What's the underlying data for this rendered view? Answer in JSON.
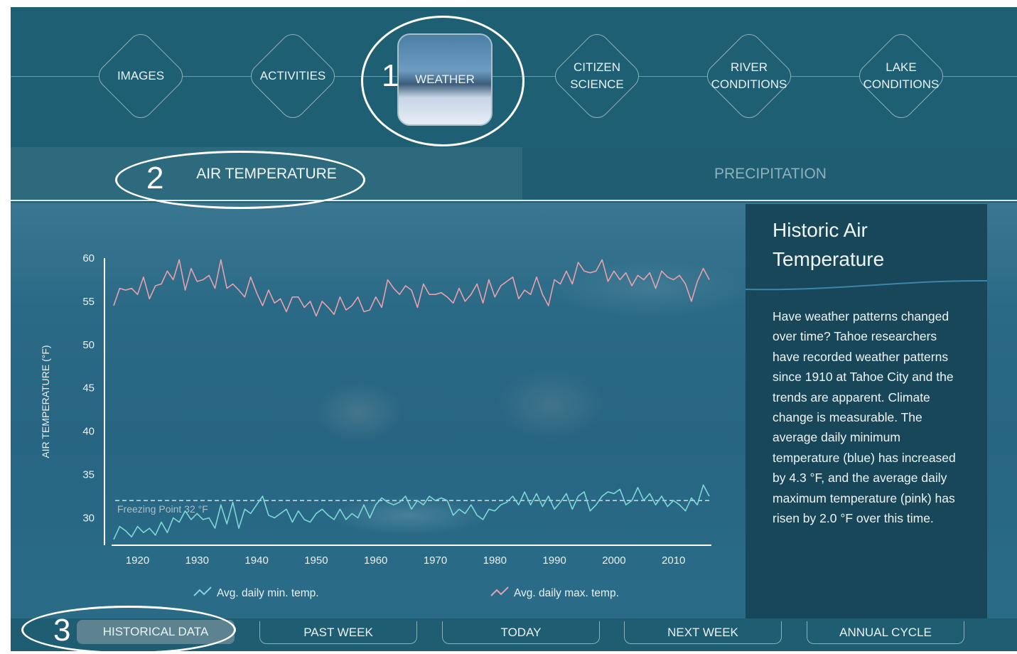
{
  "nav": {
    "items": [
      {
        "lines": [
          "IMAGES"
        ],
        "active": false
      },
      {
        "lines": [
          "ACTIVITIES"
        ],
        "active": false
      },
      {
        "lines": [
          "WEATHER"
        ],
        "active": true
      },
      {
        "lines": [
          "CITIZEN",
          "SCIENCE"
        ],
        "active": false
      },
      {
        "lines": [
          "RIVER",
          "CONDITIONS"
        ],
        "active": false
      },
      {
        "lines": [
          "LAKE",
          "CONDITIONS"
        ],
        "active": false
      }
    ]
  },
  "tabs": {
    "air": "AIR TEMPERATURE",
    "precip": "PRECIPITATION",
    "active": "air"
  },
  "info": {
    "title": "Historic Air Temperature",
    "text": "Have weather patterns changed over time? Tahoe researchers have recorded weather patterns since 1910 at Tahoe City and the trends are apparent. Climate change is measurable. The average daily minimum temperature (blue) has increased by 4.3 °F, and the average daily maximum temperature (pink) has risen by 2.0 °F over this time."
  },
  "bottom": {
    "buttons": [
      "HISTORICAL DATA",
      "PAST WEEK",
      "TODAY",
      "NEXT WEEK",
      "ANNUAL CYCLE"
    ],
    "active": 0
  },
  "annotations": [
    "1",
    "2",
    "3"
  ],
  "colors": {
    "min_series": "#7fd6d6",
    "max_series": "#e9a0ad",
    "freezing_line": "#cfe0e6",
    "panel_bg": "#18475a"
  },
  "chart_data": {
    "type": "line",
    "ylabel": "AIR TEMPERATURE (°F)",
    "xlabel": "",
    "xlim": [
      1916,
      2016
    ],
    "ylim": [
      27,
      60
    ],
    "yticks": [
      30,
      35,
      40,
      45,
      50,
      55,
      60
    ],
    "xticks": [
      1920,
      1930,
      1940,
      1950,
      1960,
      1970,
      1980,
      1990,
      2000,
      2010
    ],
    "annotation": {
      "label": "Freezing Point 32 °F",
      "y": 32
    },
    "legend": {
      "placement": "bottom"
    },
    "series": [
      {
        "name": "Avg. daily max. temp.",
        "color": "#e9a0ad",
        "x": [
          1916,
          1917,
          1918,
          1919,
          1920,
          1921,
          1922,
          1923,
          1924,
          1925,
          1926,
          1927,
          1928,
          1929,
          1930,
          1931,
          1932,
          1933,
          1934,
          1935,
          1936,
          1937,
          1938,
          1939,
          1940,
          1941,
          1942,
          1943,
          1944,
          1945,
          1946,
          1947,
          1948,
          1949,
          1950,
          1951,
          1952,
          1953,
          1954,
          1955,
          1956,
          1957,
          1958,
          1959,
          1960,
          1961,
          1962,
          1963,
          1964,
          1965,
          1966,
          1967,
          1968,
          1969,
          1970,
          1971,
          1972,
          1973,
          1974,
          1975,
          1976,
          1977,
          1978,
          1979,
          1980,
          1981,
          1982,
          1983,
          1984,
          1985,
          1986,
          1987,
          1988,
          1989,
          1990,
          1991,
          1992,
          1993,
          1994,
          1995,
          1996,
          1997,
          1998,
          1999,
          2000,
          2001,
          2002,
          2003,
          2004,
          2005,
          2006,
          2007,
          2008,
          2009,
          2010,
          2011,
          2012,
          2013,
          2014,
          2015,
          2016
        ],
        "values": [
          54.5,
          56.5,
          56.3,
          56.5,
          55.8,
          57.8,
          55.3,
          56.8,
          57.0,
          58.5,
          57.5,
          59.8,
          56.3,
          58.8,
          57.3,
          57.5,
          58.0,
          56.5,
          59.8,
          56.5,
          57.0,
          56.3,
          55.5,
          57.8,
          56.0,
          54.5,
          56.3,
          54.8,
          55.3,
          53.8,
          55.5,
          55.5,
          54.3,
          55.0,
          53.3,
          55.0,
          54.3,
          53.5,
          55.5,
          54.0,
          54.5,
          55.5,
          53.8,
          54.0,
          55.5,
          54.3,
          57.5,
          56.5,
          55.8,
          56.8,
          56.3,
          54.3,
          57.0,
          55.8,
          55.8,
          56.0,
          55.5,
          54.8,
          56.5,
          55.0,
          55.8,
          57.0,
          54.8,
          57.5,
          55.5,
          56.8,
          57.3,
          57.8,
          55.3,
          56.3,
          55.8,
          57.8,
          55.8,
          54.5,
          57.5,
          57.0,
          58.5,
          57.0,
          59.5,
          58.5,
          58.3,
          58.5,
          59.8,
          57.3,
          58.5,
          57.5,
          58.3,
          56.8,
          58.0,
          57.5,
          58.3,
          56.5,
          58.5,
          57.8,
          57.5,
          58.0,
          57.0,
          55.0,
          57.3,
          58.8,
          57.5
        ]
      },
      {
        "name": "Avg. daily min. temp.",
        "color": "#7fd6d6",
        "x": [
          1916,
          1917,
          1918,
          1919,
          1920,
          1921,
          1922,
          1923,
          1924,
          1925,
          1926,
          1927,
          1928,
          1929,
          1930,
          1931,
          1932,
          1933,
          1934,
          1935,
          1936,
          1937,
          1938,
          1939,
          1940,
          1941,
          1942,
          1943,
          1944,
          1945,
          1946,
          1947,
          1948,
          1949,
          1950,
          1951,
          1952,
          1953,
          1954,
          1955,
          1956,
          1957,
          1958,
          1959,
          1960,
          1961,
          1962,
          1963,
          1964,
          1965,
          1966,
          1967,
          1968,
          1969,
          1970,
          1971,
          1972,
          1973,
          1974,
          1975,
          1976,
          1977,
          1978,
          1979,
          1980,
          1981,
          1982,
          1983,
          1984,
          1985,
          1986,
          1987,
          1988,
          1989,
          1990,
          1991,
          1992,
          1993,
          1994,
          1995,
          1996,
          1997,
          1998,
          1999,
          2000,
          2001,
          2002,
          2003,
          2004,
          2005,
          2006,
          2007,
          2008,
          2009,
          2010,
          2011,
          2012,
          2013,
          2014,
          2015,
          2016
        ],
        "values": [
          27.5,
          29.0,
          28.5,
          27.8,
          29.0,
          28.3,
          28.8,
          28.0,
          29.5,
          28.3,
          30.0,
          29.5,
          30.8,
          29.8,
          30.5,
          29.8,
          30.0,
          28.8,
          31.5,
          29.3,
          31.8,
          28.8,
          31.0,
          30.5,
          31.5,
          32.5,
          30.3,
          30.0,
          30.5,
          31.0,
          29.5,
          30.8,
          29.8,
          29.5,
          30.5,
          31.0,
          30.3,
          29.8,
          31.0,
          29.8,
          30.5,
          30.0,
          31.5,
          30.0,
          31.5,
          32.3,
          31.8,
          31.5,
          31.8,
          32.5,
          31.0,
          32.0,
          31.5,
          32.5,
          32.0,
          32.3,
          32.0,
          30.3,
          31.0,
          30.5,
          31.5,
          30.3,
          29.8,
          31.0,
          30.8,
          31.5,
          31.8,
          32.5,
          31.5,
          33.0,
          31.5,
          32.8,
          31.3,
          32.5,
          31.0,
          31.8,
          32.8,
          31.0,
          32.5,
          33.0,
          30.8,
          31.5,
          32.5,
          33.0,
          32.8,
          33.3,
          31.5,
          32.0,
          33.5,
          32.0,
          32.8,
          31.5,
          32.5,
          31.3,
          32.0,
          31.5,
          30.8,
          32.3,
          31.5,
          33.8,
          32.5
        ]
      }
    ]
  }
}
